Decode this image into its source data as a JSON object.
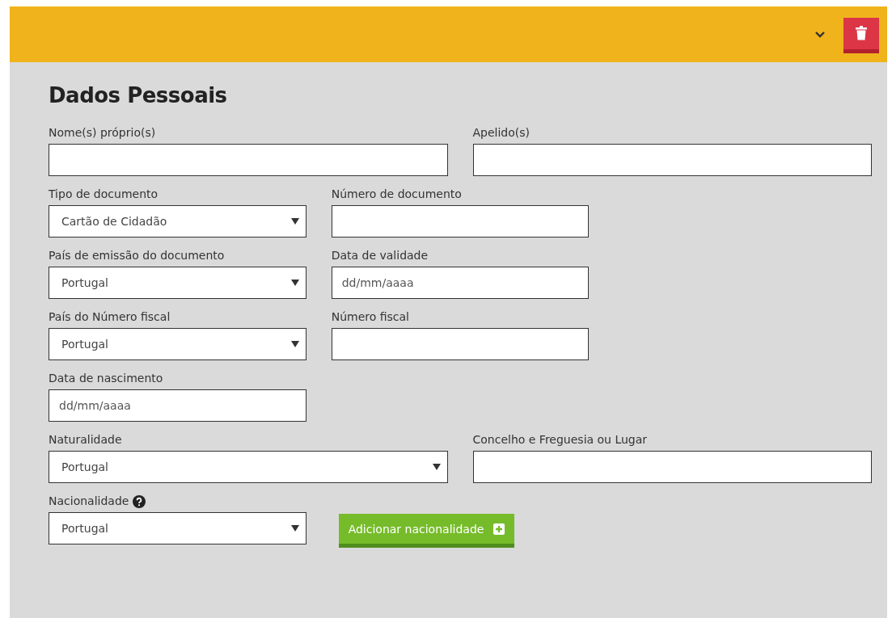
{
  "section": {
    "title": "Dados Pessoais"
  },
  "rows": [
    {
      "fields": [
        {
          "label": "Nome(s) próprio(s)",
          "kind": "text",
          "wide": true
        },
        {
          "label": "Apelido(s)",
          "kind": "text",
          "wide": true
        }
      ]
    },
    {
      "fields": [
        {
          "label": "Tipo de documento",
          "kind": "select",
          "wide": false,
          "value": "Cartão de Cidadão"
        },
        {
          "label": "Número de documento",
          "kind": "text",
          "wide": false
        }
      ]
    },
    {
      "fields": [
        {
          "label": "País de emissão do documento",
          "kind": "select",
          "wide": false,
          "value": "Portugal"
        },
        {
          "label": "Data de validade",
          "kind": "text",
          "wide": false,
          "placeholder": "dd/mm/aaaa"
        }
      ]
    },
    {
      "fields": [
        {
          "label": "País do Número fiscal",
          "kind": "select",
          "wide": false,
          "value": "Portugal"
        },
        {
          "label": "Número fiscal",
          "kind": "text",
          "wide": false
        }
      ]
    },
    {
      "fields": [
        {
          "label": "Data de nascimento",
          "kind": "text",
          "wide": false,
          "placeholder": "dd/mm/aaaa"
        }
      ]
    },
    {
      "fields": [
        {
          "label": "Naturalidade",
          "kind": "select",
          "wide": true,
          "value": "Portugal"
        },
        {
          "label": "Concelho e Freguesia ou Lugar",
          "kind": "text",
          "wide": true
        }
      ]
    },
    {
      "fields": [
        {
          "label": "Nacionalidade",
          "kind": "select",
          "wide": false,
          "value": "Portugal",
          "help": true
        },
        {
          "kind": "button",
          "label": "Adicionar nacionalidade"
        }
      ]
    }
  ]
}
